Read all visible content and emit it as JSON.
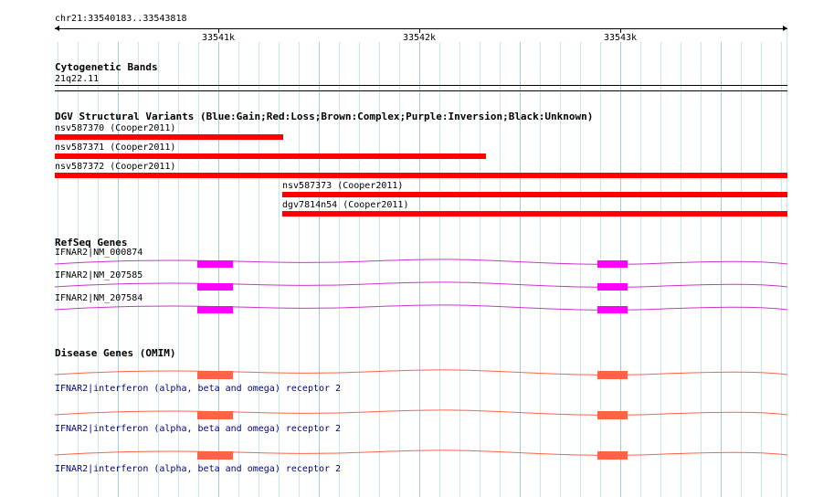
{
  "ruler": {
    "location": "chr21:33540183..33543818",
    "ticks": [
      "33541k",
      "33542k",
      "33543k"
    ]
  },
  "tracks": {
    "cytobands": {
      "title": "Cytogenetic Bands",
      "band": "21q22.11"
    },
    "dgv": {
      "title": "DGV Structural Variants (Blue:Gain;Red:Loss;Brown:Complex;Purple:Inversion;Black:Unknown)",
      "loss_color": "#ff0000",
      "features": [
        {
          "label": "nsv587370 (Cooper2011)"
        },
        {
          "label": "nsv587371 (Cooper2011)"
        },
        {
          "label": "nsv587372 (Cooper2011)"
        },
        {
          "label": "nsv587373 (Cooper2011)"
        },
        {
          "label": "dgv7814n54 (Cooper2011)"
        }
      ]
    },
    "refseq": {
      "title": "RefSeq Genes",
      "color": "#ff00ff",
      "line_color": "#cc33cc",
      "transcripts": [
        {
          "label": "IFNAR2|NM_000874"
        },
        {
          "label": "IFNAR2|NM_207585"
        },
        {
          "label": "IFNAR2|NM_207584"
        }
      ]
    },
    "omim": {
      "title": "Disease Genes (OMIM)",
      "color": "#ff6347",
      "entries": [
        {
          "label": "IFNAR2|interferon (alpha, beta and omega) receptor 2"
        },
        {
          "label": "IFNAR2|interferon (alpha, beta and omega) receptor 2"
        },
        {
          "label": "IFNAR2|interferon (alpha, beta and omega) receptor 2"
        }
      ]
    }
  }
}
